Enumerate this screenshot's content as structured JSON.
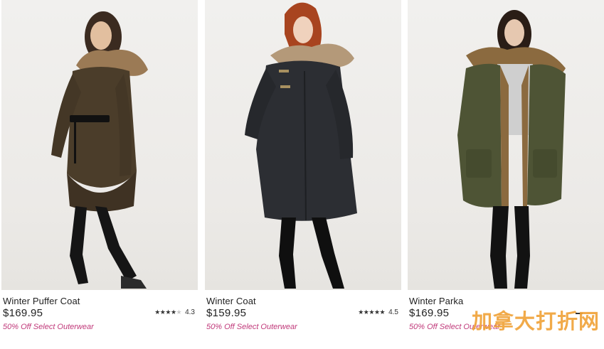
{
  "accent_color": "#c0397a",
  "watermark": {
    "text": "加拿大打折网",
    "color": "#f0a33a"
  },
  "products": [
    {
      "name": "Winter Puffer Coat",
      "price": "$169.95",
      "promo": "50% Off Select Outerwear",
      "rating_value": "4.3",
      "rating_stars": 4.3,
      "coat_color": "#4b3d2a",
      "image_alt": "woman in brown belted puffer coat with fur hood"
    },
    {
      "name": "Winter Coat",
      "price": "$159.95",
      "promo": "50% Off Select Outerwear",
      "rating_value": "4.5",
      "rating_stars": 4.5,
      "coat_color": "#2c2e33",
      "image_alt": "woman in black coat with fur hood"
    },
    {
      "name": "Winter Parka",
      "price": "$169.95",
      "promo": "50% Off Select Outerwear",
      "coat_color": "#4e5435",
      "image_alt": "woman in olive green parka with fur lining"
    }
  ]
}
